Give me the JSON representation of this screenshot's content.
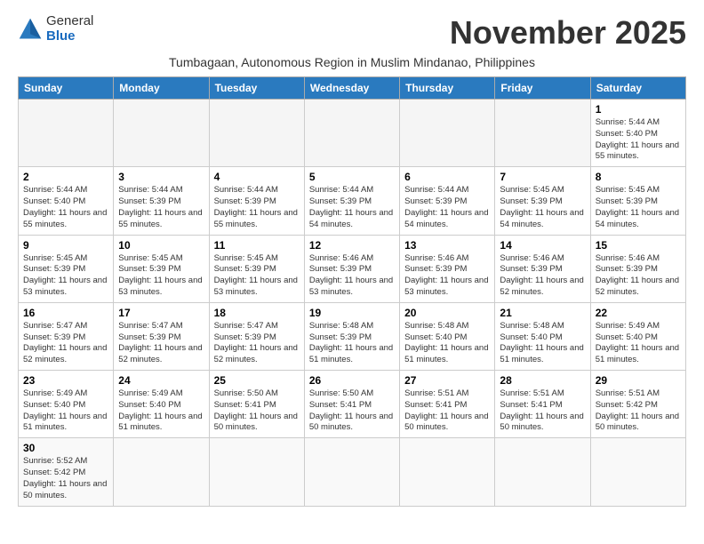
{
  "header": {
    "logo_line1": "General",
    "logo_line2": "Blue",
    "month_title": "November 2025",
    "subtitle": "Tumbagaan, Autonomous Region in Muslim Mindanao, Philippines"
  },
  "weekdays": [
    "Sunday",
    "Monday",
    "Tuesday",
    "Wednesday",
    "Thursday",
    "Friday",
    "Saturday"
  ],
  "days": {
    "d1": {
      "num": "1",
      "sr": "5:44 AM",
      "ss": "5:40 PM",
      "dl": "11 hours and 55 minutes."
    },
    "d2": {
      "num": "2",
      "sr": "5:44 AM",
      "ss": "5:40 PM",
      "dl": "11 hours and 55 minutes."
    },
    "d3": {
      "num": "3",
      "sr": "5:44 AM",
      "ss": "5:39 PM",
      "dl": "11 hours and 55 minutes."
    },
    "d4": {
      "num": "4",
      "sr": "5:44 AM",
      "ss": "5:39 PM",
      "dl": "11 hours and 55 minutes."
    },
    "d5": {
      "num": "5",
      "sr": "5:44 AM",
      "ss": "5:39 PM",
      "dl": "11 hours and 54 minutes."
    },
    "d6": {
      "num": "6",
      "sr": "5:44 AM",
      "ss": "5:39 PM",
      "dl": "11 hours and 54 minutes."
    },
    "d7": {
      "num": "7",
      "sr": "5:45 AM",
      "ss": "5:39 PM",
      "dl": "11 hours and 54 minutes."
    },
    "d8": {
      "num": "8",
      "sr": "5:45 AM",
      "ss": "5:39 PM",
      "dl": "11 hours and 54 minutes."
    },
    "d9": {
      "num": "9",
      "sr": "5:45 AM",
      "ss": "5:39 PM",
      "dl": "11 hours and 53 minutes."
    },
    "d10": {
      "num": "10",
      "sr": "5:45 AM",
      "ss": "5:39 PM",
      "dl": "11 hours and 53 minutes."
    },
    "d11": {
      "num": "11",
      "sr": "5:45 AM",
      "ss": "5:39 PM",
      "dl": "11 hours and 53 minutes."
    },
    "d12": {
      "num": "12",
      "sr": "5:46 AM",
      "ss": "5:39 PM",
      "dl": "11 hours and 53 minutes."
    },
    "d13": {
      "num": "13",
      "sr": "5:46 AM",
      "ss": "5:39 PM",
      "dl": "11 hours and 53 minutes."
    },
    "d14": {
      "num": "14",
      "sr": "5:46 AM",
      "ss": "5:39 PM",
      "dl": "11 hours and 52 minutes."
    },
    "d15": {
      "num": "15",
      "sr": "5:46 AM",
      "ss": "5:39 PM",
      "dl": "11 hours and 52 minutes."
    },
    "d16": {
      "num": "16",
      "sr": "5:47 AM",
      "ss": "5:39 PM",
      "dl": "11 hours and 52 minutes."
    },
    "d17": {
      "num": "17",
      "sr": "5:47 AM",
      "ss": "5:39 PM",
      "dl": "11 hours and 52 minutes."
    },
    "d18": {
      "num": "18",
      "sr": "5:47 AM",
      "ss": "5:39 PM",
      "dl": "11 hours and 52 minutes."
    },
    "d19": {
      "num": "19",
      "sr": "5:48 AM",
      "ss": "5:39 PM",
      "dl": "11 hours and 51 minutes."
    },
    "d20": {
      "num": "20",
      "sr": "5:48 AM",
      "ss": "5:40 PM",
      "dl": "11 hours and 51 minutes."
    },
    "d21": {
      "num": "21",
      "sr": "5:48 AM",
      "ss": "5:40 PM",
      "dl": "11 hours and 51 minutes."
    },
    "d22": {
      "num": "22",
      "sr": "5:49 AM",
      "ss": "5:40 PM",
      "dl": "11 hours and 51 minutes."
    },
    "d23": {
      "num": "23",
      "sr": "5:49 AM",
      "ss": "5:40 PM",
      "dl": "11 hours and 51 minutes."
    },
    "d24": {
      "num": "24",
      "sr": "5:49 AM",
      "ss": "5:40 PM",
      "dl": "11 hours and 51 minutes."
    },
    "d25": {
      "num": "25",
      "sr": "5:50 AM",
      "ss": "5:41 PM",
      "dl": "11 hours and 50 minutes."
    },
    "d26": {
      "num": "26",
      "sr": "5:50 AM",
      "ss": "5:41 PM",
      "dl": "11 hours and 50 minutes."
    },
    "d27": {
      "num": "27",
      "sr": "5:51 AM",
      "ss": "5:41 PM",
      "dl": "11 hours and 50 minutes."
    },
    "d28": {
      "num": "28",
      "sr": "5:51 AM",
      "ss": "5:41 PM",
      "dl": "11 hours and 50 minutes."
    },
    "d29": {
      "num": "29",
      "sr": "5:51 AM",
      "ss": "5:42 PM",
      "dl": "11 hours and 50 minutes."
    },
    "d30": {
      "num": "30",
      "sr": "5:52 AM",
      "ss": "5:42 PM",
      "dl": "11 hours and 50 minutes."
    }
  },
  "labels": {
    "sunrise": "Sunrise:",
    "sunset": "Sunset:",
    "daylight": "Daylight:"
  }
}
